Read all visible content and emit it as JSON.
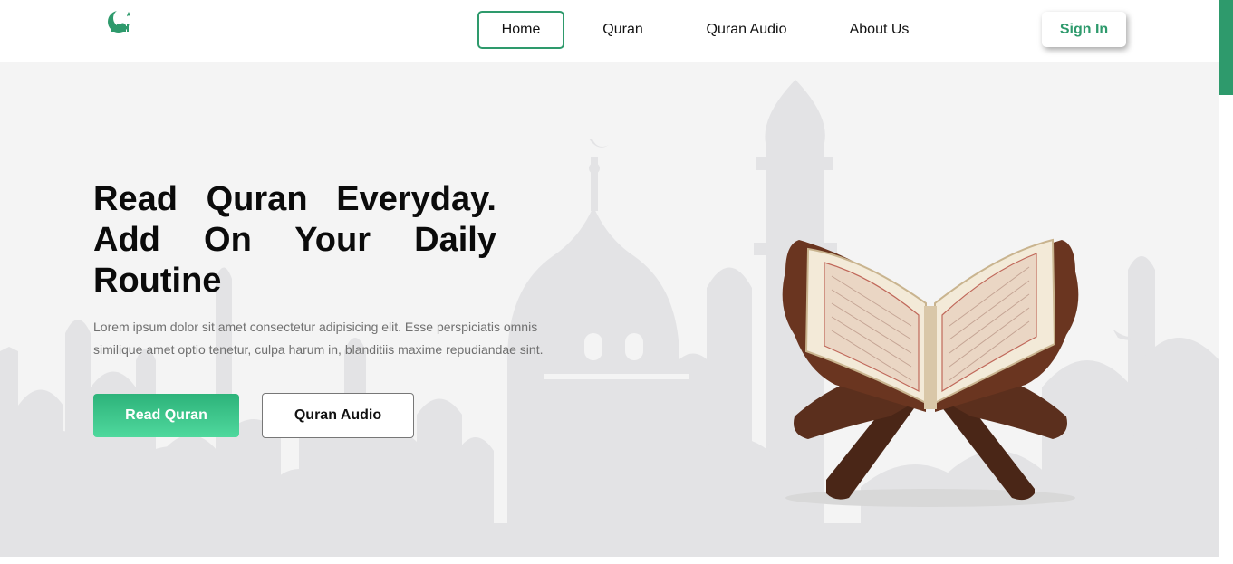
{
  "header": {
    "logo_icon": "crescent-mosque-logo-icon",
    "nav": [
      {
        "label": "Home",
        "active": true
      },
      {
        "label": "Quran",
        "active": false
      },
      {
        "label": "Quran Audio",
        "active": false
      },
      {
        "label": "About Us",
        "active": false
      }
    ],
    "signin_label": "Sign In"
  },
  "hero": {
    "title": "Read Quran Everyday. Add On Your Daily Routine",
    "description": "Lorem ipsum dolor sit amet consectetur adipisicing elit. Esse perspiciatis omnis similique amet optio tenetur, culpa harum in, blanditiis maxime repudiandae sint.",
    "primary_button": "Read Quran",
    "secondary_button": "Quran Audio",
    "image": "open-quran-on-wooden-stand"
  },
  "colors": {
    "accent": "#2e9a6c",
    "button_gradient_top": "#2db37a",
    "button_gradient_bottom": "#4fd89d",
    "hero_background": "#f4f4f4",
    "silhouette": "#e3e3e5",
    "text_muted": "#707070"
  }
}
